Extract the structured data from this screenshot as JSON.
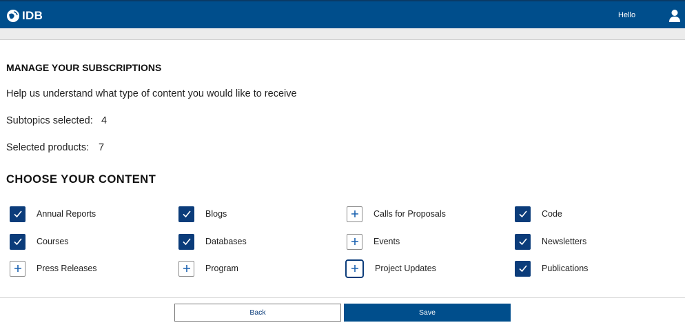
{
  "header": {
    "logo_text": "IDB",
    "greeting": "Hello",
    "brand_color": "#004e8c"
  },
  "page": {
    "title": "MANAGE YOUR SUBSCRIPTIONS",
    "help_text": "Help us understand what type of content you would like to receive",
    "subtopics_label": "Subtopics selected:",
    "subtopics_value": "4",
    "products_label": "Selected products:",
    "products_value": "7",
    "choose_heading": "CHOOSE YOUR CONTENT"
  },
  "options": [
    {
      "label": "Annual Reports",
      "selected": true
    },
    {
      "label": "Blogs",
      "selected": true
    },
    {
      "label": "Calls for Proposals",
      "selected": false
    },
    {
      "label": "Code",
      "selected": true
    },
    {
      "label": "Courses",
      "selected": true
    },
    {
      "label": "Databases",
      "selected": true
    },
    {
      "label": "Events",
      "selected": false
    },
    {
      "label": "Newsletters",
      "selected": true
    },
    {
      "label": "Press Releases",
      "selected": false
    },
    {
      "label": "Program",
      "selected": false
    },
    {
      "label": "Project Updates",
      "selected": false,
      "focused": true
    },
    {
      "label": "Publications",
      "selected": true
    }
  ],
  "buttons": {
    "back_label": "Back",
    "save_label": "Save"
  }
}
